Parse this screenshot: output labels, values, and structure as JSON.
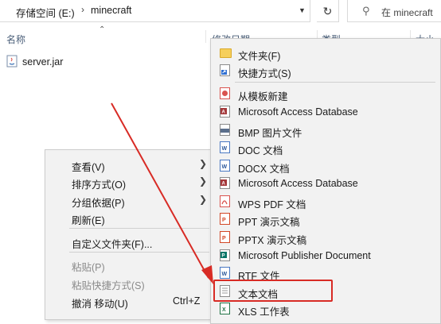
{
  "address_bar": {
    "crumbs": [
      "存储空间 (E:)",
      "minecraft"
    ],
    "separator": "›"
  },
  "search": {
    "placeholder": "在 minecraft"
  },
  "columns": {
    "name": "名称",
    "date": "修改日期",
    "type": "类型",
    "size": "大小"
  },
  "files": [
    {
      "name": "server.jar",
      "icon": "java-jar-icon"
    }
  ],
  "context_menu": {
    "items": [
      {
        "label": "查看(V)",
        "submenu": true,
        "enabled": true
      },
      {
        "label": "排序方式(O)",
        "submenu": true,
        "enabled": true
      },
      {
        "label": "分组依据(P)",
        "submenu": true,
        "enabled": true
      },
      {
        "label": "刷新(E)",
        "submenu": false,
        "enabled": true
      },
      {
        "label": "自定义文件夹(F)...",
        "submenu": false,
        "enabled": true
      },
      {
        "label": "粘贴(P)",
        "submenu": false,
        "enabled": false
      },
      {
        "label": "粘贴快捷方式(S)",
        "submenu": false,
        "enabled": false
      },
      {
        "label": "撤消 移动(U)",
        "shortcut": "Ctrl+Z",
        "submenu": false,
        "enabled": true
      }
    ]
  },
  "new_submenu": {
    "items": [
      {
        "label": "文件夹(F)",
        "icon": "folder-icon"
      },
      {
        "label": "快捷方式(S)",
        "icon": "shortcut-icon"
      },
      {
        "label": "从模板新建",
        "icon": "wps-template-icon"
      },
      {
        "label": "Microsoft Access Database",
        "icon": "access-icon"
      },
      {
        "label": "BMP 图片文件",
        "icon": "bmp-icon"
      },
      {
        "label": "DOC 文档",
        "icon": "doc-icon"
      },
      {
        "label": "DOCX 文档",
        "icon": "docx-icon"
      },
      {
        "label": "Microsoft Access Database",
        "icon": "access-icon"
      },
      {
        "label": "WPS PDF 文档",
        "icon": "pdf-icon"
      },
      {
        "label": "PPT 演示文稿",
        "icon": "ppt-icon"
      },
      {
        "label": "PPTX 演示文稿",
        "icon": "pptx-icon"
      },
      {
        "label": "Microsoft Publisher Document",
        "icon": "publisher-icon"
      },
      {
        "label": "RTF 文件",
        "icon": "rtf-icon"
      },
      {
        "label": "文本文档",
        "icon": "text-document-icon",
        "highlighted": true
      },
      {
        "label": "XLS 工作表",
        "icon": "xls-icon"
      }
    ]
  },
  "colors": {
    "annotation": "#d82b25",
    "menu_bg": "#f2f2f2",
    "header_text": "#4c607a"
  }
}
